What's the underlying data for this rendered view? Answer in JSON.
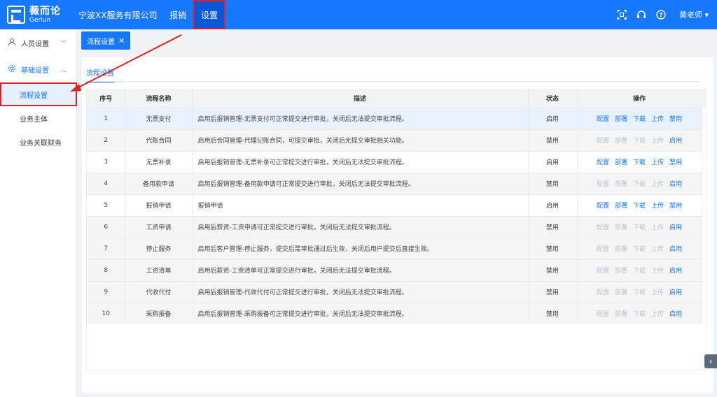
{
  "header": {
    "logo_cn": "薇而论",
    "logo_en": "Gerlun",
    "company": "宁波XX服务有限公司",
    "nav": [
      {
        "label": "报销"
      },
      {
        "label": "设置"
      }
    ],
    "user": "黄老师 ▾",
    "icons": [
      "scan-icon",
      "headset-icon",
      "help-icon"
    ]
  },
  "sidebar": {
    "groups": [
      {
        "label": "人员设置",
        "icon": "user-icon",
        "chevron": "﹀"
      },
      {
        "label": "基础设置",
        "icon": "gear-icon",
        "chevron": "︿"
      }
    ],
    "items": [
      {
        "label": "流程设置"
      },
      {
        "label": "业务主体"
      },
      {
        "label": "业务关联财务"
      }
    ]
  },
  "tabbar": {
    "tag_label": "流程设置",
    "close": "✕"
  },
  "content": {
    "inner_tab": "流程设置",
    "columns": [
      "序号",
      "流程名称",
      "描述",
      "状态",
      "操作"
    ],
    "rows": [
      {
        "no": "1",
        "name": "无票支付",
        "desc": "启用后报销管理-无票支付可正常提交进行审批，关闭后无法提交审批流程。",
        "status": "启用",
        "enabled": true
      },
      {
        "no": "2",
        "name": "代账合同",
        "desc": "启用后合同管理-代理记账合同，可提交审批，关闭后无提交审批相关功能。",
        "status": "禁用",
        "enabled": false
      },
      {
        "no": "3",
        "name": "无票补录",
        "desc": "启用后报销管理-无票补录可正常提交进行审批，关闭后无法提交审批流程。",
        "status": "启用",
        "enabled": true
      },
      {
        "no": "4",
        "name": "备用款申请",
        "desc": "启用后报销管理-备用款申请可正常提交进行审批，关闭后无法提交审批流程。",
        "status": "禁用",
        "enabled": false
      },
      {
        "no": "5",
        "name": "报销申请",
        "desc": "报销申请",
        "status": "启用",
        "enabled": true
      },
      {
        "no": "6",
        "name": "工资申请",
        "desc": "启用后薪资-工资申请可正常提交进行审批，关闭后无法提交审批流程。",
        "status": "禁用",
        "enabled": false
      },
      {
        "no": "7",
        "name": "停止服务",
        "desc": "启用后客户管理-停止服务，提交后需审批通过后生效，关闭后用户提交后直接生效。",
        "status": "禁用",
        "enabled": false
      },
      {
        "no": "8",
        "name": "工资清单",
        "desc": "启用后薪资-工资清单可正常提交进行审批，关闭后无法提交审批流程。",
        "status": "禁用",
        "enabled": false
      },
      {
        "no": "9",
        "name": "代收代付",
        "desc": "启用后报销管理-代收代付可正常提交进行审批，关闭后无法提交审批流程。",
        "status": "禁用",
        "enabled": false
      },
      {
        "no": "10",
        "name": "采购报备",
        "desc": "启用后报销管理-采购报备可正常提交进行审批，关闭后无法提交审批流程。",
        "status": "禁用",
        "enabled": false
      }
    ],
    "actions": {
      "configure": "配置",
      "deploy": "部署",
      "download": "下载",
      "upload": "上传",
      "disable": "禁用",
      "enable": "启用"
    }
  },
  "collapse_icon": "‹",
  "colors": {
    "primary": "#1677ff",
    "highlight_border": "#e02020",
    "disabled_action": "#b8c3d1"
  }
}
